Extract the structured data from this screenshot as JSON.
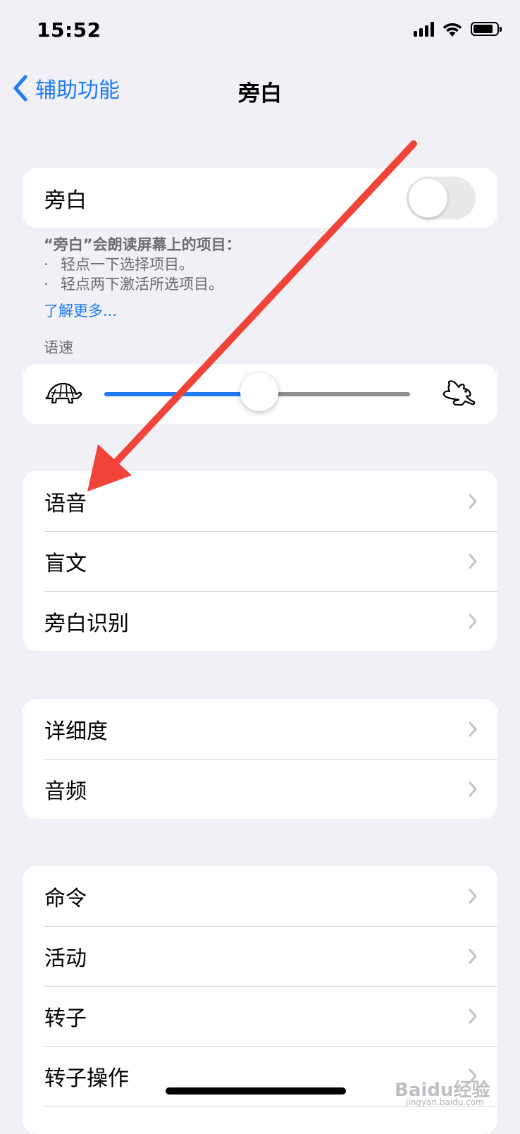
{
  "status_bar": {
    "time": "15:52"
  },
  "nav": {
    "back_label": "辅助功能",
    "title": "旁白"
  },
  "voiceover_toggle": {
    "label": "旁白",
    "on": false
  },
  "description": {
    "title": "“旁白”会朗读屏幕上的项目：",
    "bullets": [
      "轻点一下选择项目。",
      "轻点两下激活所选项目。"
    ],
    "learn_more": "了解更多..."
  },
  "speaking_rate": {
    "header": "语速",
    "value_fraction": 0.5,
    "min_icon": "turtle-icon",
    "max_icon": "rabbit-icon"
  },
  "groups": [
    {
      "items": [
        {
          "label": "语音"
        },
        {
          "label": "盲文"
        },
        {
          "label": "旁白识别"
        }
      ]
    },
    {
      "items": [
        {
          "label": "详细度"
        },
        {
          "label": "音频"
        }
      ]
    },
    {
      "items": [
        {
          "label": "命令"
        },
        {
          "label": "活动"
        },
        {
          "label": "转子"
        },
        {
          "label": "转子操作"
        }
      ]
    }
  ],
  "watermark": {
    "text": "Baidu经验",
    "sub": "jingyan.baidu.com"
  },
  "colors": {
    "accent": "#1f7bf6",
    "background": "#f0f0f6",
    "arrow": "#f0443a"
  }
}
